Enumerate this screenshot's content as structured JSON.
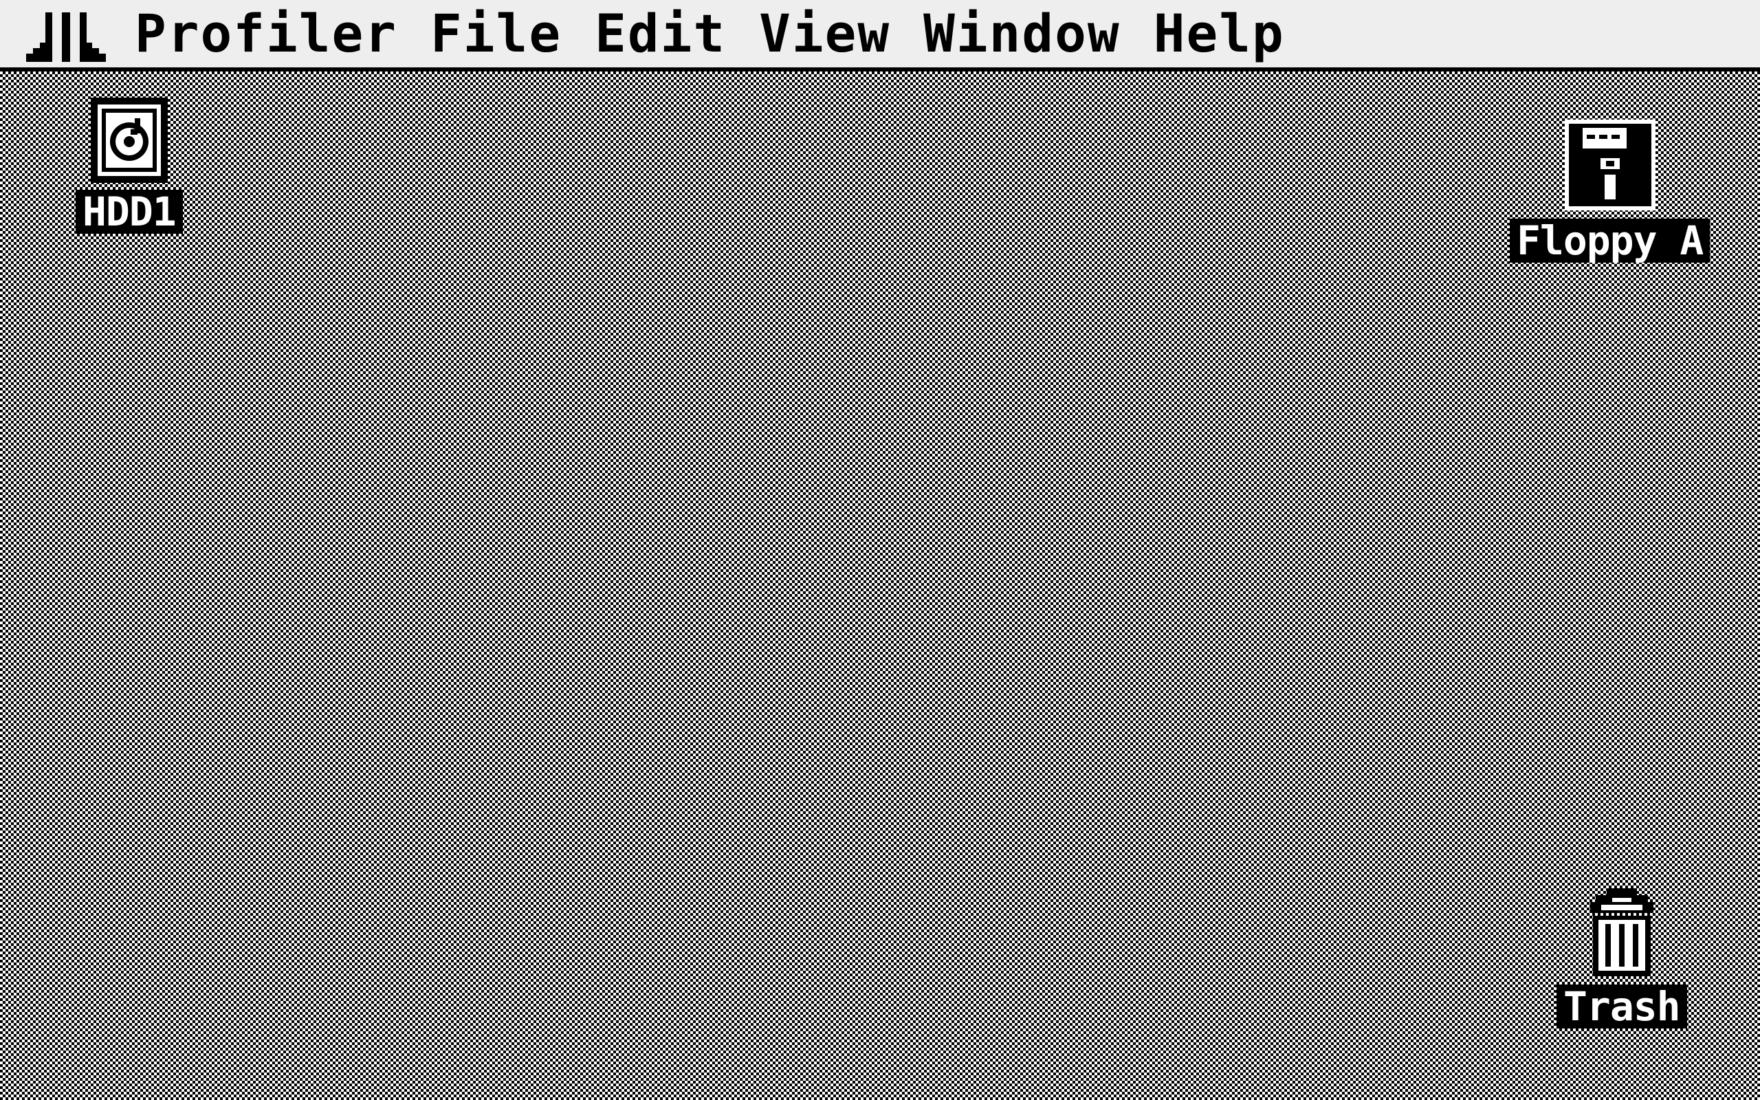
{
  "menubar": {
    "logo_icon": "atari-fuji-icon",
    "items": [
      {
        "label": "Profiler"
      },
      {
        "label": "File"
      },
      {
        "label": "Edit"
      },
      {
        "label": "View"
      },
      {
        "label": "Window"
      },
      {
        "label": "Help"
      }
    ]
  },
  "desktop": {
    "pattern_colors": {
      "dark": "#000000",
      "light": "#ffffff"
    },
    "icons": [
      {
        "label": "HDD1",
        "icon": "hard-disk-icon"
      },
      {
        "label": "Floppy A",
        "icon": "floppy-disk-icon"
      },
      {
        "label": "Trash",
        "icon": "trash-can-icon"
      }
    ]
  }
}
